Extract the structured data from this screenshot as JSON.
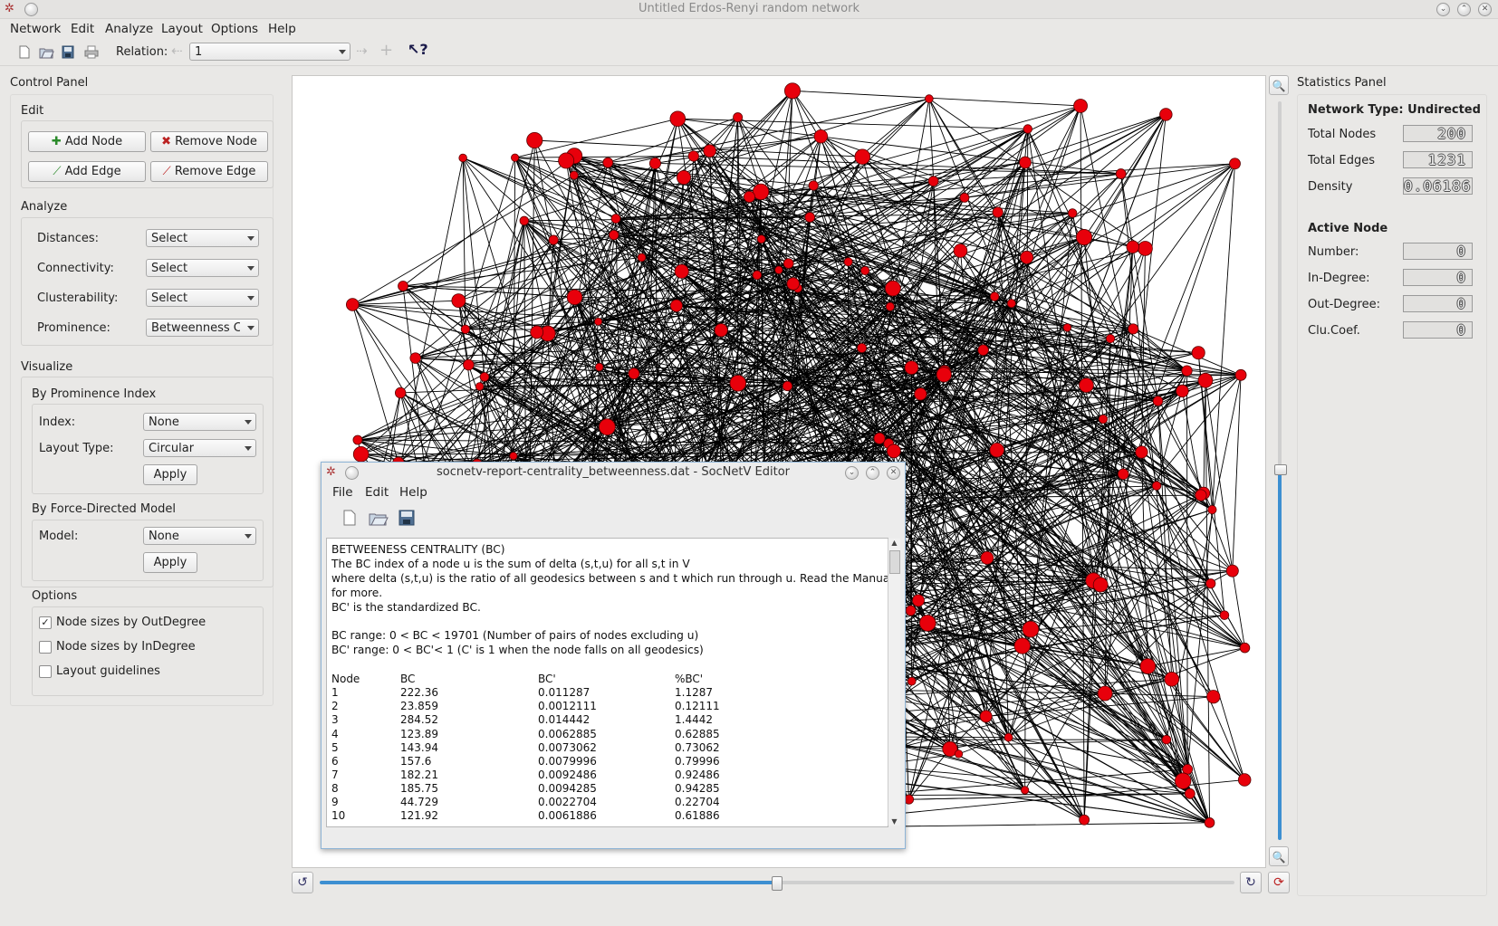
{
  "window": {
    "title": "Untitled Erdos-Renyi random network"
  },
  "menubar": [
    "Network",
    "Edit",
    "Analyze",
    "Layout",
    "Options",
    "Help"
  ],
  "toolbar": {
    "relation_label": "Relation:",
    "relation_value": "1"
  },
  "control_panel": {
    "title": "Control Panel",
    "edit": {
      "title": "Edit",
      "add_node": "Add Node",
      "remove_node": "Remove Node",
      "add_edge": "Add Edge",
      "remove_edge": "Remove Edge"
    },
    "analyze": {
      "title": "Analyze",
      "distances": {
        "label": "Distances:",
        "value": "Select"
      },
      "connectivity": {
        "label": "Connectivity:",
        "value": "Select"
      },
      "clusterability": {
        "label": "Clusterability:",
        "value": "Select"
      },
      "prominence": {
        "label": "Prominence:",
        "value": "Betweenness Ce"
      }
    },
    "visualize": {
      "title": "Visualize",
      "by_prominence": {
        "title": "By Prominence Index",
        "index_label": "Index:",
        "index_value": "None",
        "layout_label": "Layout Type:",
        "layout_value": "Circular",
        "apply": "Apply"
      },
      "by_force": {
        "title": "By Force-Directed Model",
        "model_label": "Model:",
        "model_value": "None",
        "apply": "Apply"
      }
    },
    "options": {
      "title": "Options",
      "items": [
        {
          "label": "Node sizes by OutDegree",
          "checked": true
        },
        {
          "label": "Node sizes by InDegree",
          "checked": false
        },
        {
          "label": "Layout guidelines",
          "checked": false
        }
      ]
    }
  },
  "statistics_panel": {
    "title": "Statistics Panel",
    "network_type": "Network Type: Undirected",
    "total_nodes": {
      "label": "Total Nodes",
      "value": "200"
    },
    "total_edges": {
      "label": "Total Edges",
      "value": "1231"
    },
    "density": {
      "label": "Density",
      "value": "0.06186"
    },
    "active_node_title": "Active Node",
    "number": {
      "label": "Number:",
      "value": "0"
    },
    "in_degree": {
      "label": "In-Degree:",
      "value": "0"
    },
    "out_degree": {
      "label": "Out-Degree:",
      "value": "0"
    },
    "clu_coef": {
      "label": "Clu.Coef.",
      "value": "0"
    }
  },
  "graph": {
    "node_color": "#e8000b",
    "edge_color": "#000000"
  },
  "editor": {
    "title": "socnetv-report-centrality_betweenness.dat - SocNetV Editor",
    "menu": [
      "File",
      "Edit",
      "Help"
    ],
    "text_lines": [
      "BETWEENESS CENTRALITY (BC)",
      "The BC index of a node u is the sum of delta (s,t,u) for all s,t in V",
      "where delta (s,t,u) is the ratio of all geodesics between s and t which run through u. Read the Manual",
      "for more.",
      "BC' is the standardized BC.",
      "",
      "BC  range: 0 < BC < 19701 (Number of pairs of nodes excluding u)",
      "BC' range: 0 < BC'< 1  (C' is 1 when the node falls on all geodesics)",
      ""
    ],
    "table_header": [
      "Node",
      "BC",
      "BC'",
      "%BC'"
    ],
    "table_rows": [
      [
        "1",
        "222.36",
        "0.011287",
        "1.1287"
      ],
      [
        "2",
        "23.859",
        "0.0012111",
        "0.12111"
      ],
      [
        "3",
        "284.52",
        "0.014442",
        "1.4442"
      ],
      [
        "4",
        "123.89",
        "0.0062885",
        "0.62885"
      ],
      [
        "5",
        "143.94",
        "0.0073062",
        "0.73062"
      ],
      [
        "6",
        "157.6",
        "0.0079996",
        "0.79996"
      ],
      [
        "7",
        "182.21",
        "0.0092486",
        "0.92486"
      ],
      [
        "8",
        "185.75",
        "0.0094285",
        "0.94285"
      ],
      [
        "9",
        "44.729",
        "0.0022704",
        "0.22704"
      ],
      [
        "10",
        "121.92",
        "0.0061886",
        "0.61886"
      ]
    ]
  }
}
